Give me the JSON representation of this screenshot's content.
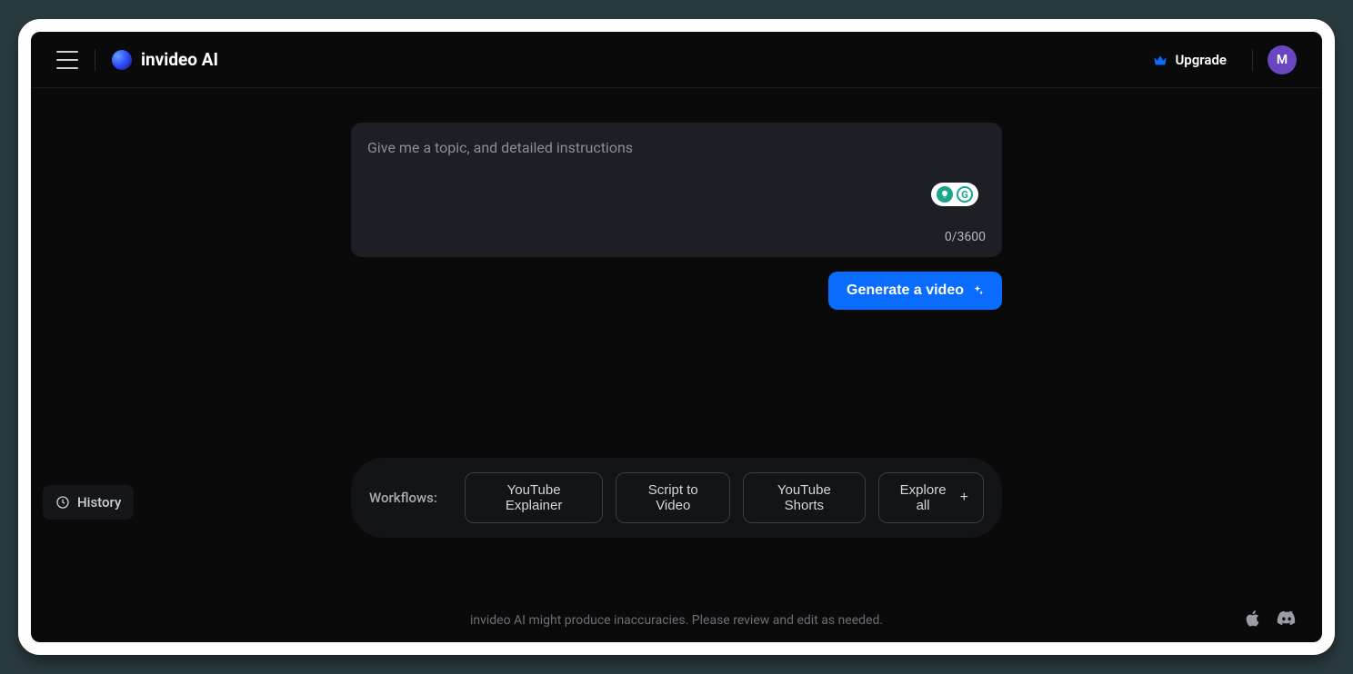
{
  "header": {
    "brand": "invideo AI",
    "upgrade_label": "Upgrade",
    "avatar_initial": "M"
  },
  "prompt": {
    "placeholder": "Give me a topic, and detailed instructions",
    "value": "",
    "char_count": "0/3600"
  },
  "actions": {
    "generate_label": "Generate a video"
  },
  "history": {
    "label": "History"
  },
  "workflows": {
    "label": "Workflows:",
    "items": [
      "YouTube Explainer",
      "Script to Video",
      "YouTube Shorts"
    ],
    "explore_label": "Explore all"
  },
  "footer": {
    "disclaimer": "invideo AI might produce inaccuracies. Please review and edit as needed."
  }
}
